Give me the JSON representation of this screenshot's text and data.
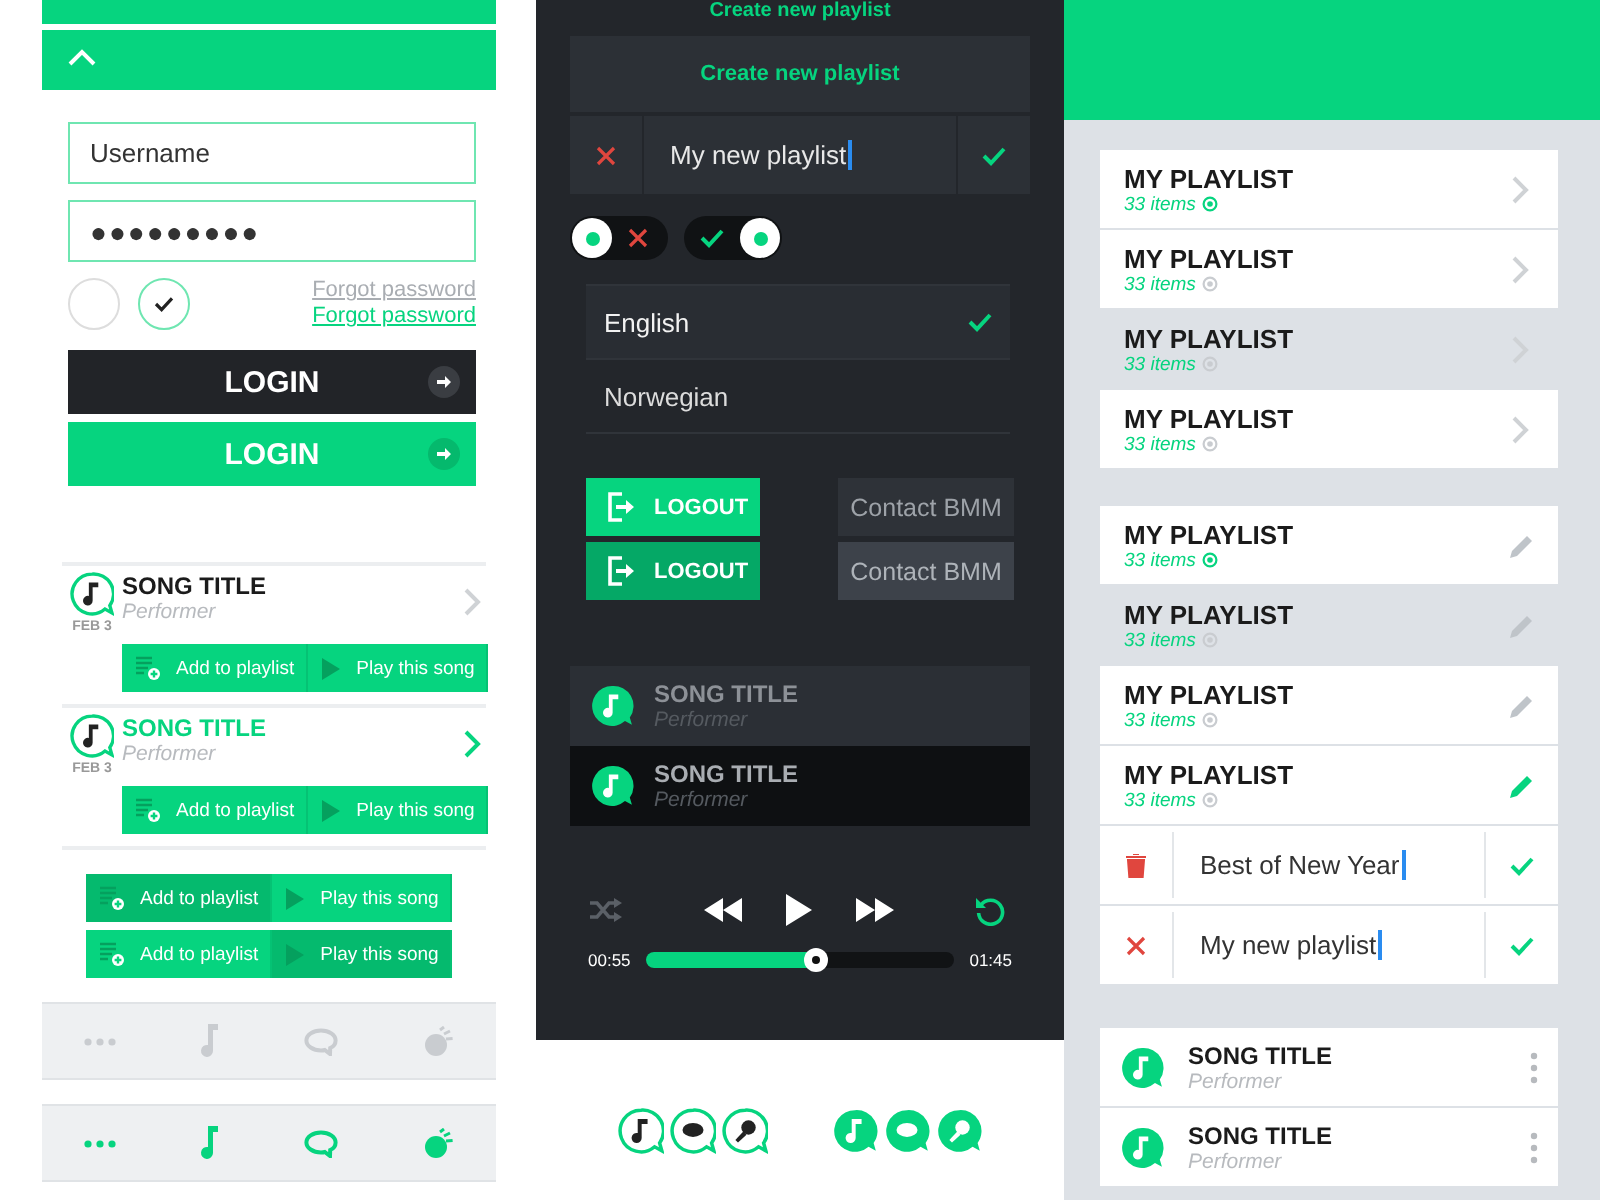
{
  "accordion": {
    "expanded": true
  },
  "login_form": {
    "username": {
      "placeholder": "Username"
    },
    "password": {
      "value": "●●●●●●●●●"
    },
    "options": [
      {
        "checked": false
      },
      {
        "checked": true
      }
    ],
    "forgot_links": [
      {
        "label": "Forgot password",
        "disabled": true
      },
      {
        "label": "Forgot password",
        "disabled": false
      }
    ],
    "buttons": [
      {
        "label": "LOGIN",
        "kind": "dark"
      },
      {
        "label": "LOGIN",
        "kind": "primary"
      }
    ]
  },
  "song_cards": [
    {
      "title": "SONG TITLE",
      "performer": "Performer",
      "date": "FEB 3",
      "selected": false,
      "actions": [
        {
          "label": "Add to playlist",
          "kind": "add",
          "pressed": false
        },
        {
          "label": "Play this song",
          "kind": "play",
          "pressed": false
        }
      ]
    },
    {
      "title": "SONG TITLE",
      "performer": "Performer",
      "date": "FEB 3",
      "selected": true,
      "actions": [
        {
          "label": "Add to playlist",
          "kind": "add",
          "pressed": false
        },
        {
          "label": "Play this song",
          "kind": "play",
          "pressed": false
        }
      ]
    }
  ],
  "action_groups": [
    {
      "actions": [
        {
          "label": "Add to playlist",
          "kind": "add",
          "pressed": true
        },
        {
          "label": "Play this song",
          "kind": "play",
          "pressed": false
        }
      ]
    },
    {
      "actions": [
        {
          "label": "Add to playlist",
          "kind": "add",
          "pressed": false
        },
        {
          "label": "Play this song",
          "kind": "play",
          "pressed": true
        }
      ]
    }
  ],
  "tab_bars": [
    {
      "active": false
    },
    {
      "active": true
    }
  ],
  "dark_panel": {
    "caption": "Create new playlist",
    "create_button": "Create new playlist",
    "name_field": {
      "value": "My new playlist"
    },
    "toggles": [
      {
        "on": false
      },
      {
        "on": true
      }
    ],
    "languages": [
      {
        "label": "English",
        "selected": true
      },
      {
        "label": "Norwegian",
        "selected": false
      }
    ],
    "logout_buttons": [
      {
        "label": "LOGOUT",
        "pressed": false
      },
      {
        "label": "LOGOUT",
        "pressed": true
      }
    ],
    "contact_buttons": [
      {
        "label": "Contact BMM",
        "pressed": false
      },
      {
        "label": "Contact BMM",
        "pressed": true
      }
    ],
    "songs": [
      {
        "title": "SONG TITLE",
        "performer": "Performer",
        "selected": false
      },
      {
        "title": "SONG TITLE",
        "performer": "Performer",
        "selected": true
      }
    ],
    "player": {
      "shuffle": false,
      "repeat": true,
      "elapsed": "00:55",
      "total": "01:45",
      "level": 0.55
    }
  },
  "badge_sets": [
    {
      "filled": false
    },
    {
      "filled": true
    }
  ],
  "playlists": [
    {
      "title": "MY PLAYLIST",
      "count": "33 items",
      "synced": true,
      "highlighted": false
    },
    {
      "title": "MY PLAYLIST",
      "count": "33 items",
      "synced": false,
      "highlighted": false
    },
    {
      "title": "MY PLAYLIST",
      "count": "33 items",
      "synced": false,
      "highlighted": true
    },
    {
      "title": "MY PLAYLIST",
      "count": "33 items",
      "synced": false,
      "highlighted": false
    }
  ],
  "editable_playlists": [
    {
      "title": "MY PLAYLIST",
      "count": "33 items",
      "synced": true,
      "highlighted": false,
      "editing": false
    },
    {
      "title": "MY PLAYLIST",
      "count": "33 items",
      "synced": false,
      "highlighted": true,
      "editing": false
    },
    {
      "title": "MY PLAYLIST",
      "count": "33 items",
      "synced": false,
      "highlighted": false,
      "editing": false
    },
    {
      "title": "MY PLAYLIST",
      "count": "33 items",
      "synced": false,
      "highlighted": false,
      "editing": true
    }
  ],
  "edit_rows": [
    {
      "kind": "delete",
      "value": "Best of New Year"
    },
    {
      "kind": "cancel",
      "value": "My new playlist"
    }
  ],
  "playlist_songs": [
    {
      "title": "SONG TITLE",
      "performer": "Performer"
    },
    {
      "title": "SONG TITLE",
      "performer": "Performer"
    }
  ]
}
